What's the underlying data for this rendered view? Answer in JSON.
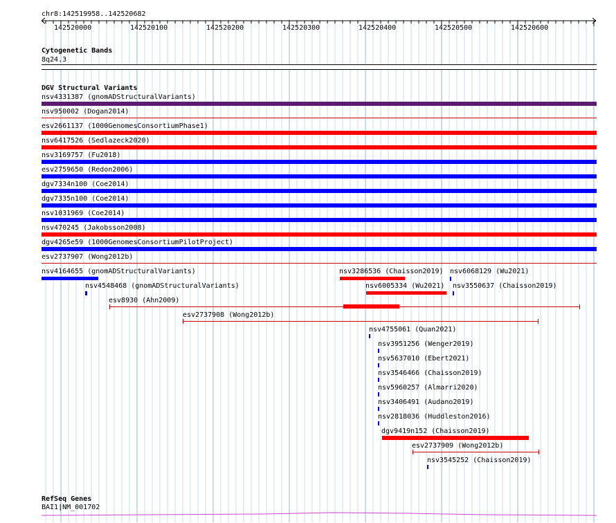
{
  "locus": "chr8:142519958..142520682",
  "ruler": {
    "ticks": [
      "142520000",
      "142520100",
      "142520200",
      "142520300",
      "142520400",
      "142520500",
      "142520600"
    ]
  },
  "cytoband": {
    "title": "Cytogenetic Bands",
    "band": "8q24.3"
  },
  "dgv": {
    "title": "DGV Structural Variants",
    "colors": {
      "purple": "#5b1b6e",
      "red": "#ff0000",
      "blue": "#0000ff",
      "darkred": "#cc0000"
    },
    "full_rows": [
      {
        "label": "nsv4331387 (gnomADStructuralVariants)",
        "color": "purple"
      },
      {
        "label": "nsv950002 (Dogan2014)",
        "color": "darkred",
        "style": "thin"
      },
      {
        "label": "esv2661137 (1000GenomesConsortiumPhase1)",
        "color": "red"
      },
      {
        "label": "nsv6417526 (Sedlazeck2020)",
        "color": "red"
      },
      {
        "label": "nsv3169757 (Fu2018)",
        "color": "blue"
      },
      {
        "label": "esv2759650 (Redon2006)",
        "color": "blue"
      },
      {
        "label": "dgv7334n100 (Coe2014)",
        "color": "blue"
      },
      {
        "label": "dgv7335n100 (Coe2014)",
        "color": "blue"
      },
      {
        "label": "nsv1031969 (Coe2014)",
        "color": "blue"
      },
      {
        "label": "nsv470245 (Jakobsson2008)",
        "color": "red"
      },
      {
        "label": "dgv4265e59 (1000GenomesConsortiumPilotProject)",
        "color": "blue"
      },
      {
        "label": "esv2737907 (Wong2012b)",
        "color": "darkred",
        "style": "thin"
      }
    ],
    "partial_rows": [
      {
        "label": "nsv4164655 (gnomADStructuralVariants)",
        "color": "blue"
      },
      {
        "label": "nsv3286536 (Chaisson2019)",
        "color": "red"
      },
      {
        "label": "nsv6068129 (Wu2021)",
        "color": "blue"
      },
      {
        "label": "nsv4548468 (gnomADStructuralVariants)",
        "color": "blue"
      },
      {
        "label": "nsv6005334 (Wu2021)",
        "color": "red"
      },
      {
        "label": "nsv3550637 (Chaisson2019)",
        "color": "blue"
      },
      {
        "label": "esv8930 (Ahn2009)",
        "color": "darkred"
      },
      {
        "label": "esv2737908 (Wong2012b)",
        "color": "darkred"
      },
      {
        "label": "nsv4755061 (Quan2021)",
        "color": "blue"
      },
      {
        "label": "nsv3951256 (Wenger2019)",
        "color": "blue"
      },
      {
        "label": "nsv5637010 (Ebert2021)",
        "color": "blue"
      },
      {
        "label": "nsv3546466 (Chaisson2019)",
        "color": "blue"
      },
      {
        "label": "nsv5960257 (Almarri2020)",
        "color": "blue"
      },
      {
        "label": "nsv3406491 (Audano2019)",
        "color": "blue"
      },
      {
        "label": "nsv2818036 (Huddleston2016)",
        "color": "blue"
      },
      {
        "label": "dgv9419n152 (Chaisson2019)",
        "color": "red"
      },
      {
        "label": "esv2737909 (Wong2012b)",
        "color": "darkred"
      },
      {
        "label": "nsv3545252 (Chaisson2019)",
        "color": "blue"
      }
    ]
  },
  "refseq": {
    "title": "RefSeq Genes",
    "gene": "BAI1|NM_001702",
    "color": "#cc44cc"
  }
}
